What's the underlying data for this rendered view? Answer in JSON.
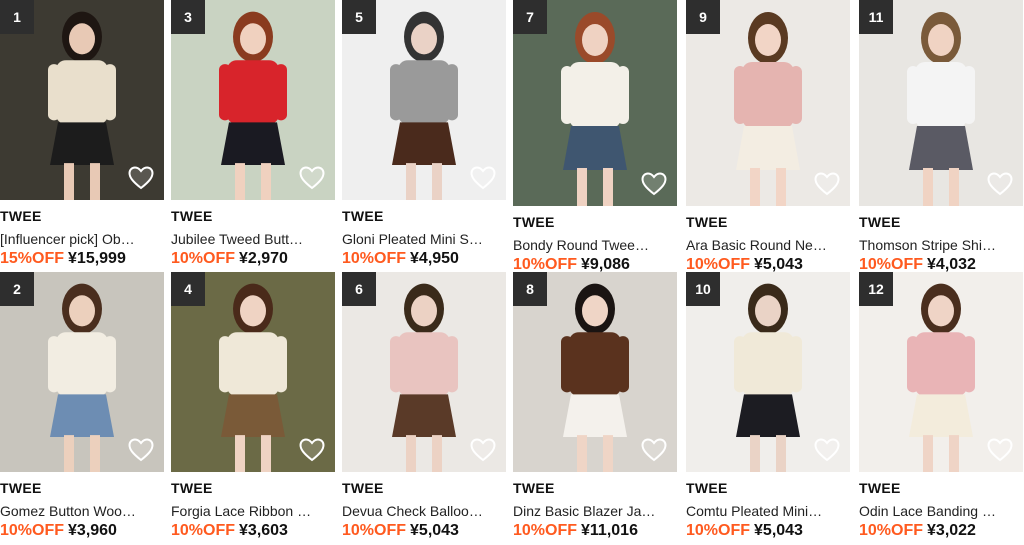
{
  "products": [
    {
      "rank": "1",
      "brand": "TWEE",
      "name": "[Influencer pick] Ob…",
      "discount": "15%OFF",
      "price": "¥15,999",
      "bg": "#3d3a32",
      "top": "#e9dfcc",
      "bottom": "#1c1c1c",
      "skin": "#e8c9b5",
      "hair": "#1e1612"
    },
    {
      "rank": "3",
      "brand": "TWEE",
      "name": "Jubilee Tweed Butt…",
      "discount": "10%OFF",
      "price": "¥2,970",
      "bg": "#c9d3c2",
      "top": "#d8242b",
      "bottom": "#1a1a22",
      "skin": "#f0d1bf",
      "hair": "#8a3b1f"
    },
    {
      "rank": "5",
      "brand": "TWEE",
      "name": "Gloni Pleated Mini S…",
      "discount": "10%OFF",
      "price": "¥4,950",
      "bg": "#efefef",
      "top": "#9a9a9a",
      "bottom": "#4a2a1c",
      "skin": "#ead2c6",
      "hair": "#333333"
    },
    {
      "rank": "7",
      "brand": "TWEE",
      "name": "Bondy Round Twee…",
      "discount": "10%OFF",
      "price": "¥9,086",
      "bg": "#5a6a58",
      "top": "#f3f0e8",
      "bottom": "#3f5670",
      "skin": "#efd2c2",
      "hair": "#9a4a2a"
    },
    {
      "rank": "9",
      "brand": "TWEE",
      "name": "Ara Basic Round Ne…",
      "discount": "10%OFF",
      "price": "¥5,043",
      "bg": "#ece9e5",
      "top": "#e5b4b0",
      "bottom": "#f3ede2",
      "skin": "#f2d5c6",
      "hair": "#5a3a22"
    },
    {
      "rank": "11",
      "brand": "TWEE",
      "name": "Thomson Stripe Shi…",
      "discount": "10%OFF",
      "price": "¥4,032",
      "bg": "#e8e6e2",
      "top": "#f4f4f4",
      "bottom": "#5a5a64",
      "skin": "#f0d3c3",
      "hair": "#7a5a3a"
    },
    {
      "rank": "2",
      "brand": "TWEE",
      "name": "Gomez Button Woo…",
      "discount": "10%OFF",
      "price": "¥3,960",
      "bg": "#c8c5bd",
      "top": "#f2ede2",
      "bottom": "#6d8db3",
      "skin": "#ecd0bd",
      "hair": "#4a2e1e"
    },
    {
      "rank": "4",
      "brand": "TWEE",
      "name": "Forgia Lace Ribbon …",
      "discount": "10%OFF",
      "price": "¥3,603",
      "bg": "#6b6a46",
      "top": "#efe8d8",
      "bottom": "#7a5a38",
      "skin": "#efd3c3",
      "hair": "#4a2a1a"
    },
    {
      "rank": "6",
      "brand": "TWEE",
      "name": "Devua Check Balloo…",
      "discount": "10%OFF",
      "price": "¥5,043",
      "bg": "#ebe8e4",
      "top": "#e9c4c0",
      "bottom": "#5a3a28",
      "skin": "#ecd2c4",
      "hair": "#3a2a1a"
    },
    {
      "rank": "8",
      "brand": "TWEE",
      "name": "Dinz Basic Blazer Ja…",
      "discount": "10%OFF",
      "price": "¥11,016",
      "bg": "#d8d4ce",
      "top": "#5a321e",
      "bottom": "#f4f1ec",
      "skin": "#efd5c6",
      "hair": "#1a1412"
    },
    {
      "rank": "10",
      "brand": "TWEE",
      "name": "Comtu Pleated Mini…",
      "discount": "10%OFF",
      "price": "¥5,043",
      "bg": "#f0eeeb",
      "top": "#f0e9d8",
      "bottom": "#1c1c22",
      "skin": "#ead3c6",
      "hair": "#3a2a1a"
    },
    {
      "rank": "12",
      "brand": "TWEE",
      "name": "Odin Lace Banding …",
      "discount": "10%OFF",
      "price": "¥3,022",
      "bg": "#f2efeb",
      "top": "#e9b4b6",
      "bottom": "#f3ecdc",
      "skin": "#efd4c6",
      "hair": "#4a2e1e"
    }
  ],
  "colors": {
    "discount": "#ff5a1f",
    "rank_badge": "#2e2e2e"
  }
}
